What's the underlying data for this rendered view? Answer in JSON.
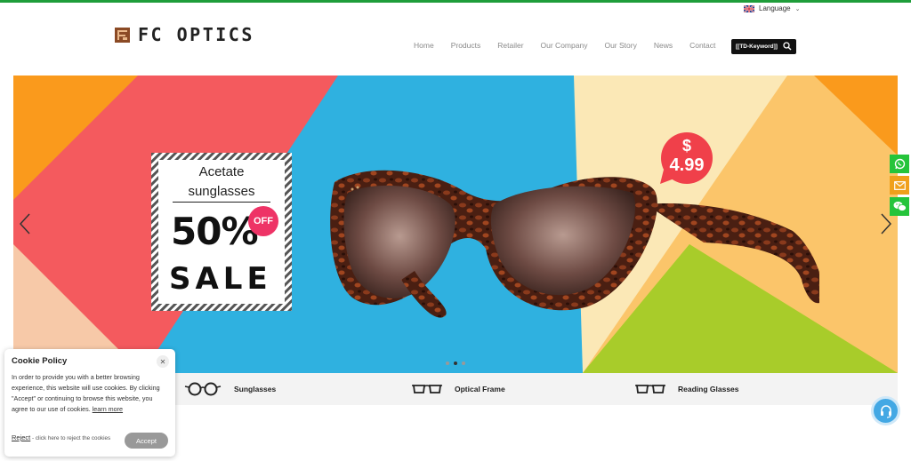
{
  "header": {
    "language_label": "Language",
    "logo_text": "FC OPTICS",
    "nav": [
      "Home",
      "Products",
      "Retailer",
      "Our Company",
      "Our Story",
      "News",
      "Contact"
    ],
    "search_keyword": "[[TD-Keyword]]"
  },
  "hero": {
    "promo_line1": "Acetate",
    "promo_line2": "sunglasses",
    "promo_percent": "50%",
    "promo_off": "OFF",
    "promo_sale": "SALE",
    "price_symbol": "$",
    "price_value": "4.99",
    "active_slide": 2,
    "slide_count": 3
  },
  "categories": [
    "Sunglasses",
    "Optical Frame",
    "Reading Glasses"
  ],
  "cookie": {
    "title": "Cookie Policy",
    "body": "In order to provide you with a better browsing experience, this website will use cookies. By clicking \"Accept\" or continuing to browse this website, you agree to our use of cookies.",
    "learn_more": "learn more",
    "reject_label": "Reject",
    "reject_note": " - click here to reject the cookies",
    "accept_label": "Accept"
  },
  "colors": {
    "top_stripe": "#1f9d3a",
    "hero_blue": "#2fb1e0",
    "hero_red": "#f45a5e",
    "hero_orange": "#fa9a1c",
    "hero_yellow_green": "#a8cc2a",
    "price_badge": "#f0404a",
    "off_badge": "#ee3366",
    "whatsapp": "#25c43b",
    "email": "#f0a01b",
    "support": "#43a8e4"
  },
  "icons": [
    "uk-flag-icon",
    "chevron-down-icon",
    "search-icon",
    "arrow-left-icon",
    "arrow-right-icon",
    "sunglasses-icon",
    "optical-frame-icon",
    "reading-glasses-icon",
    "whatsapp-icon",
    "email-icon",
    "wechat-icon",
    "close-icon",
    "headset-icon"
  ]
}
